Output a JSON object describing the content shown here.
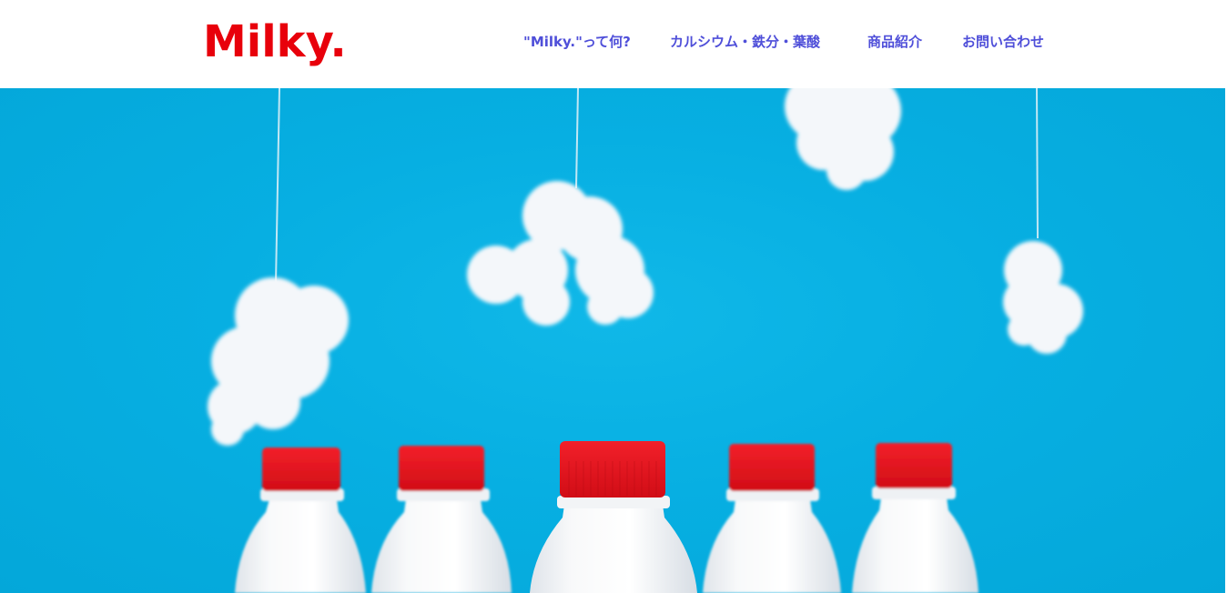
{
  "header": {
    "logo": "Milky.",
    "nav": [
      {
        "label": "\"Milky.\"って何?"
      },
      {
        "label": "カルシウム・鉄分・葉酸"
      },
      {
        "label": "商品紹介"
      },
      {
        "label": "お問い合わせ"
      }
    ]
  },
  "colors": {
    "logo": "#e8000b",
    "nav_link": "#4f4fd9",
    "hero_background": "#07afe2",
    "cap_red": "#e8101a",
    "bottle_white": "#f6f7f8"
  },
  "hero": {
    "image_description_name": "milk-bottles-clouds-hero"
  }
}
